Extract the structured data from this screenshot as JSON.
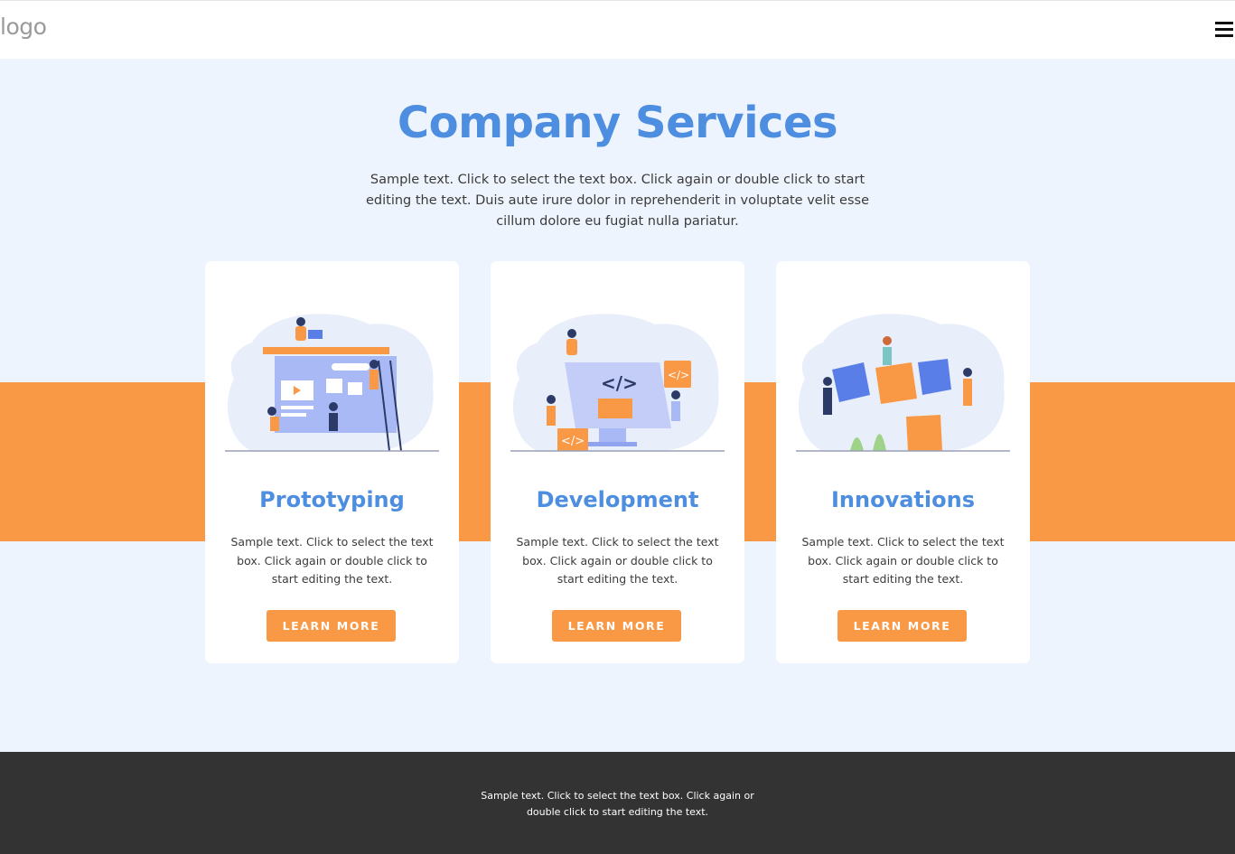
{
  "header": {
    "logo_text": "logo",
    "menu_icon": "hamburger-menu-icon"
  },
  "hero": {
    "title": "Company Services",
    "lead": "Sample text. Click to select the text box. Click again or double click to start editing the text. Duis aute irure dolor in reprehenderit in voluptate velit esse cillum dolore eu fugiat nulla pariatur."
  },
  "cards": [
    {
      "title": "Prototyping",
      "text": "Sample text. Click to select the text box. Click again or double click to start editing the text.",
      "button": "LEARN MORE",
      "illustration": "prototyping-illustration"
    },
    {
      "title": "Development",
      "text": "Sample text. Click to select the text box. Click again or double click to start editing the text.",
      "button": "LEARN MORE",
      "illustration": "development-illustration"
    },
    {
      "title": "Innovations",
      "text": "Sample text. Click to select the text box. Click again or double click to start editing the text.",
      "button": "LEARN MORE",
      "illustration": "innovations-illustration"
    }
  ],
  "footer": {
    "text": "Sample text. Click to select the text box. Click again or double click to start editing the text."
  },
  "colors": {
    "accent_blue": "#4d8ee0",
    "accent_orange": "#f99845",
    "background": "#eef4fd",
    "footer_bg": "#333333"
  }
}
